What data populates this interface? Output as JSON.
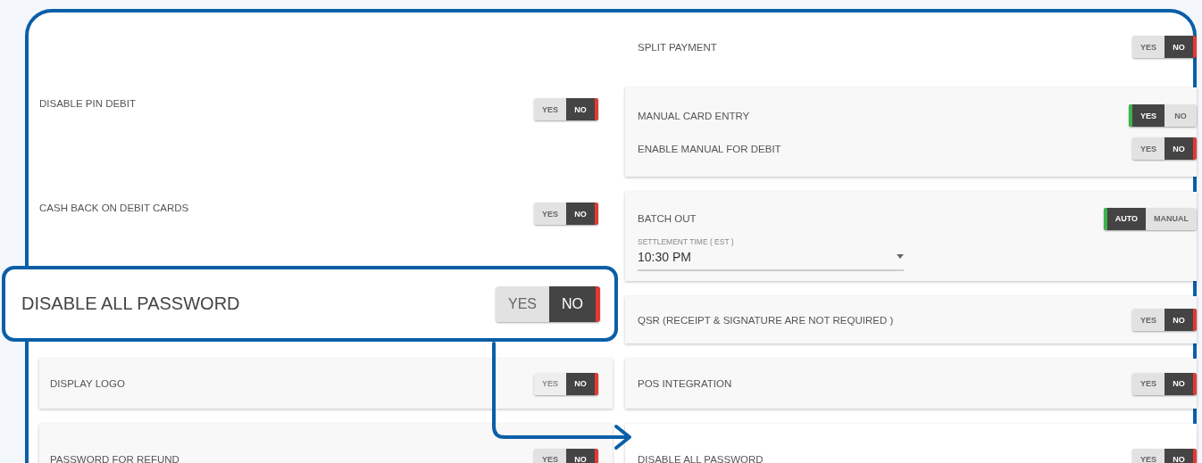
{
  "left_settings": [
    {
      "kind": "plain",
      "label": "DISABLE PIN DEBIT",
      "disabled": false,
      "options": [
        {
          "label": "YES",
          "selected": false
        },
        {
          "label": "NO",
          "selected": true
        }
      ]
    },
    {
      "kind": "plain",
      "label": "CASH BACK ON DEBIT CARDS",
      "disabled": false,
      "options": [
        {
          "label": "YES",
          "selected": false
        },
        {
          "label": "NO",
          "selected": true
        }
      ]
    },
    {
      "kind": "card",
      "label": "DISPLAY LOGO",
      "disabled": true,
      "options": [
        {
          "label": "YES",
          "selected": false
        },
        {
          "label": "NO",
          "selected": true
        }
      ]
    },
    {
      "kind": "card",
      "label": "PASSWORD FOR REFUND",
      "disabled": false,
      "options": [
        {
          "label": "YES",
          "selected": false
        },
        {
          "label": "NO",
          "selected": true
        }
      ]
    }
  ],
  "right_settings": [
    {
      "kind": "plain",
      "settings": [
        {
          "label": "SPLIT PAYMENT",
          "options": [
            {
              "label": "YES",
              "selected": false
            },
            {
              "label": "NO",
              "selected": true
            }
          ]
        }
      ]
    },
    {
      "kind": "card",
      "settings": [
        {
          "label": "MANUAL CARD ENTRY",
          "options": [
            {
              "label": "YES",
              "selected": true
            },
            {
              "label": "NO",
              "selected": false
            }
          ]
        },
        {
          "label": "ENABLE MANUAL FOR DEBIT",
          "options": [
            {
              "label": "YES",
              "selected": false
            },
            {
              "label": "NO",
              "selected": true
            }
          ]
        }
      ]
    },
    {
      "kind": "card",
      "settings": [
        {
          "label": "BATCH OUT",
          "options": [
            {
              "label": "AUTO",
              "selected": true
            },
            {
              "label": "MANUAL",
              "selected": false
            }
          ]
        }
      ],
      "field": {
        "label": "SETTLEMENT TIME ( EST )",
        "value": "10:30 PM"
      }
    },
    {
      "kind": "card",
      "settings": [
        {
          "label": "QSR (RECEIPT & SIGNATURE ARE NOT REQUIRED )",
          "options": [
            {
              "label": "YES",
              "selected": false
            },
            {
              "label": "NO",
              "selected": true
            }
          ]
        }
      ]
    },
    {
      "kind": "card",
      "settings": [
        {
          "label": "POS INTEGRATION",
          "options": [
            {
              "label": "YES",
              "selected": false
            },
            {
              "label": "NO",
              "selected": true
            }
          ]
        }
      ]
    },
    {
      "kind": "highlight",
      "settings": [
        {
          "label": "DISABLE ALL PASSWORD",
          "options": [
            {
              "label": "YES",
              "selected": false
            },
            {
              "label": "NO",
              "selected": true
            }
          ]
        }
      ]
    }
  ],
  "callout": {
    "label": "DISABLE ALL PASSWORD",
    "options": [
      {
        "label": "YES",
        "selected": false
      },
      {
        "label": "NO",
        "selected": true
      }
    ]
  }
}
